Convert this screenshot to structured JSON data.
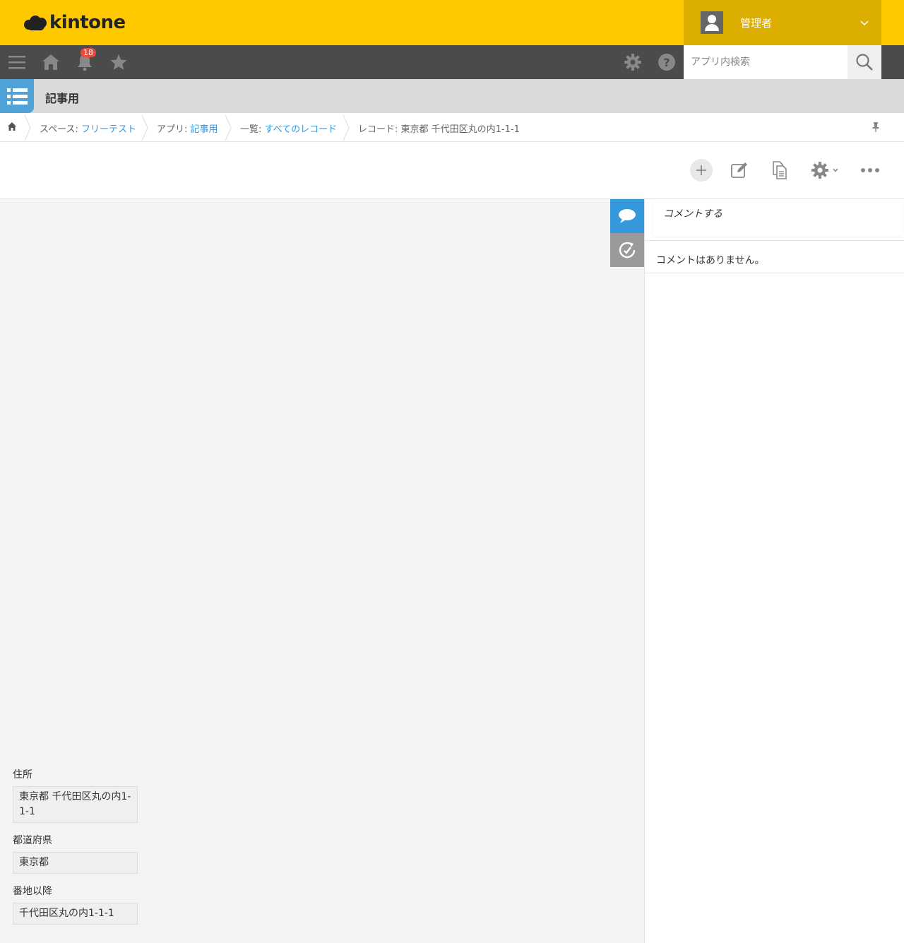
{
  "header": {
    "logo_text": "kintone",
    "user_name": "管理者"
  },
  "nav": {
    "notification_count": "18",
    "search_placeholder": "アプリ内検索"
  },
  "app": {
    "title": "記事用"
  },
  "breadcrumb": {
    "space_prefix": "スペース: ",
    "space_name": "フリーテスト",
    "app_prefix": "アプリ: ",
    "app_name": "記事用",
    "view_prefix": "一覧: ",
    "view_name": "すべてのレコード",
    "record": "レコード: 東京都 千代田区丸の内1-1-1"
  },
  "fields": [
    {
      "label": "住所",
      "value": "東京都 千代田区丸の内1-1-1"
    },
    {
      "label": "都道府県",
      "value": "東京都"
    },
    {
      "label": "番地以降",
      "value": "千代田区丸の内1-1-1"
    }
  ],
  "comments": {
    "input_placeholder": "コメントする",
    "empty_text": "コメントはありません。"
  },
  "colors": {
    "brand_yellow": "#ffc900",
    "user_box": "#dbae00",
    "nav_dark": "#4b4b4b",
    "accent_blue": "#3498db",
    "badge_red": "#e74c3c"
  }
}
